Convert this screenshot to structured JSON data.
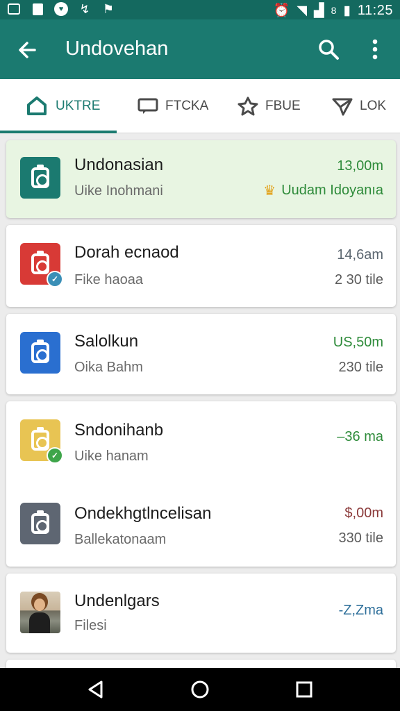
{
  "status_bar": {
    "time": "11:25",
    "battery_label": "8"
  },
  "app_bar": {
    "title": "Undovehan"
  },
  "tabs": [
    {
      "label": "UKTRE",
      "icon": "home-icon",
      "active": true
    },
    {
      "label": "FTCKA",
      "icon": "chat-icon",
      "active": false
    },
    {
      "label": "FBUE",
      "icon": "star-icon",
      "active": false
    },
    {
      "label": "LOK",
      "icon": "send-icon",
      "active": false
    }
  ],
  "items": [
    {
      "name": "Undonasian",
      "subtitle": "Uike Inohmani",
      "amount": "13,00m",
      "meta": "Uudam Idoyanıa",
      "amount_color": "#2e8b3a",
      "icon_color": "#1b7a70",
      "meta_color": "#2e8b3a"
    },
    {
      "name": "Dorah ecnaod",
      "subtitle": "Fike haoaa",
      "amount": "14,6am",
      "meta": "2 30 tile",
      "amount_color": "#5b6670",
      "icon_color": "#d83a36",
      "meta_color": "#5b5b5b"
    },
    {
      "name": "Salolkun",
      "subtitle": "Oika Bahm",
      "amount": "US,50m",
      "meta": "230 tile",
      "amount_color": "#2e8b3a",
      "icon_color": "#2a6fd0",
      "meta_color": "#5b5b5b"
    },
    {
      "name": "Sndonihanb",
      "subtitle": "Uike hanam",
      "amount": "–36 ma",
      "meta": "",
      "amount_color": "#2e8b3a",
      "icon_color": "#e8c453",
      "meta_color": "#5b5b5b"
    },
    {
      "name": "Ondekhgtlncelisan",
      "subtitle": "Ballekatonaam",
      "amount": "$,00m",
      "meta": "330 tile",
      "amount_color": "#8b3a3a",
      "icon_color": "#5e6672",
      "meta_color": "#5b5b5b"
    },
    {
      "name": "Undenlgars",
      "subtitle": "Filesi",
      "amount": "-Z,Zma",
      "meta": "",
      "amount_color": "#2e6f9a",
      "icon_color": "",
      "meta_color": "#5b5b5b"
    }
  ]
}
